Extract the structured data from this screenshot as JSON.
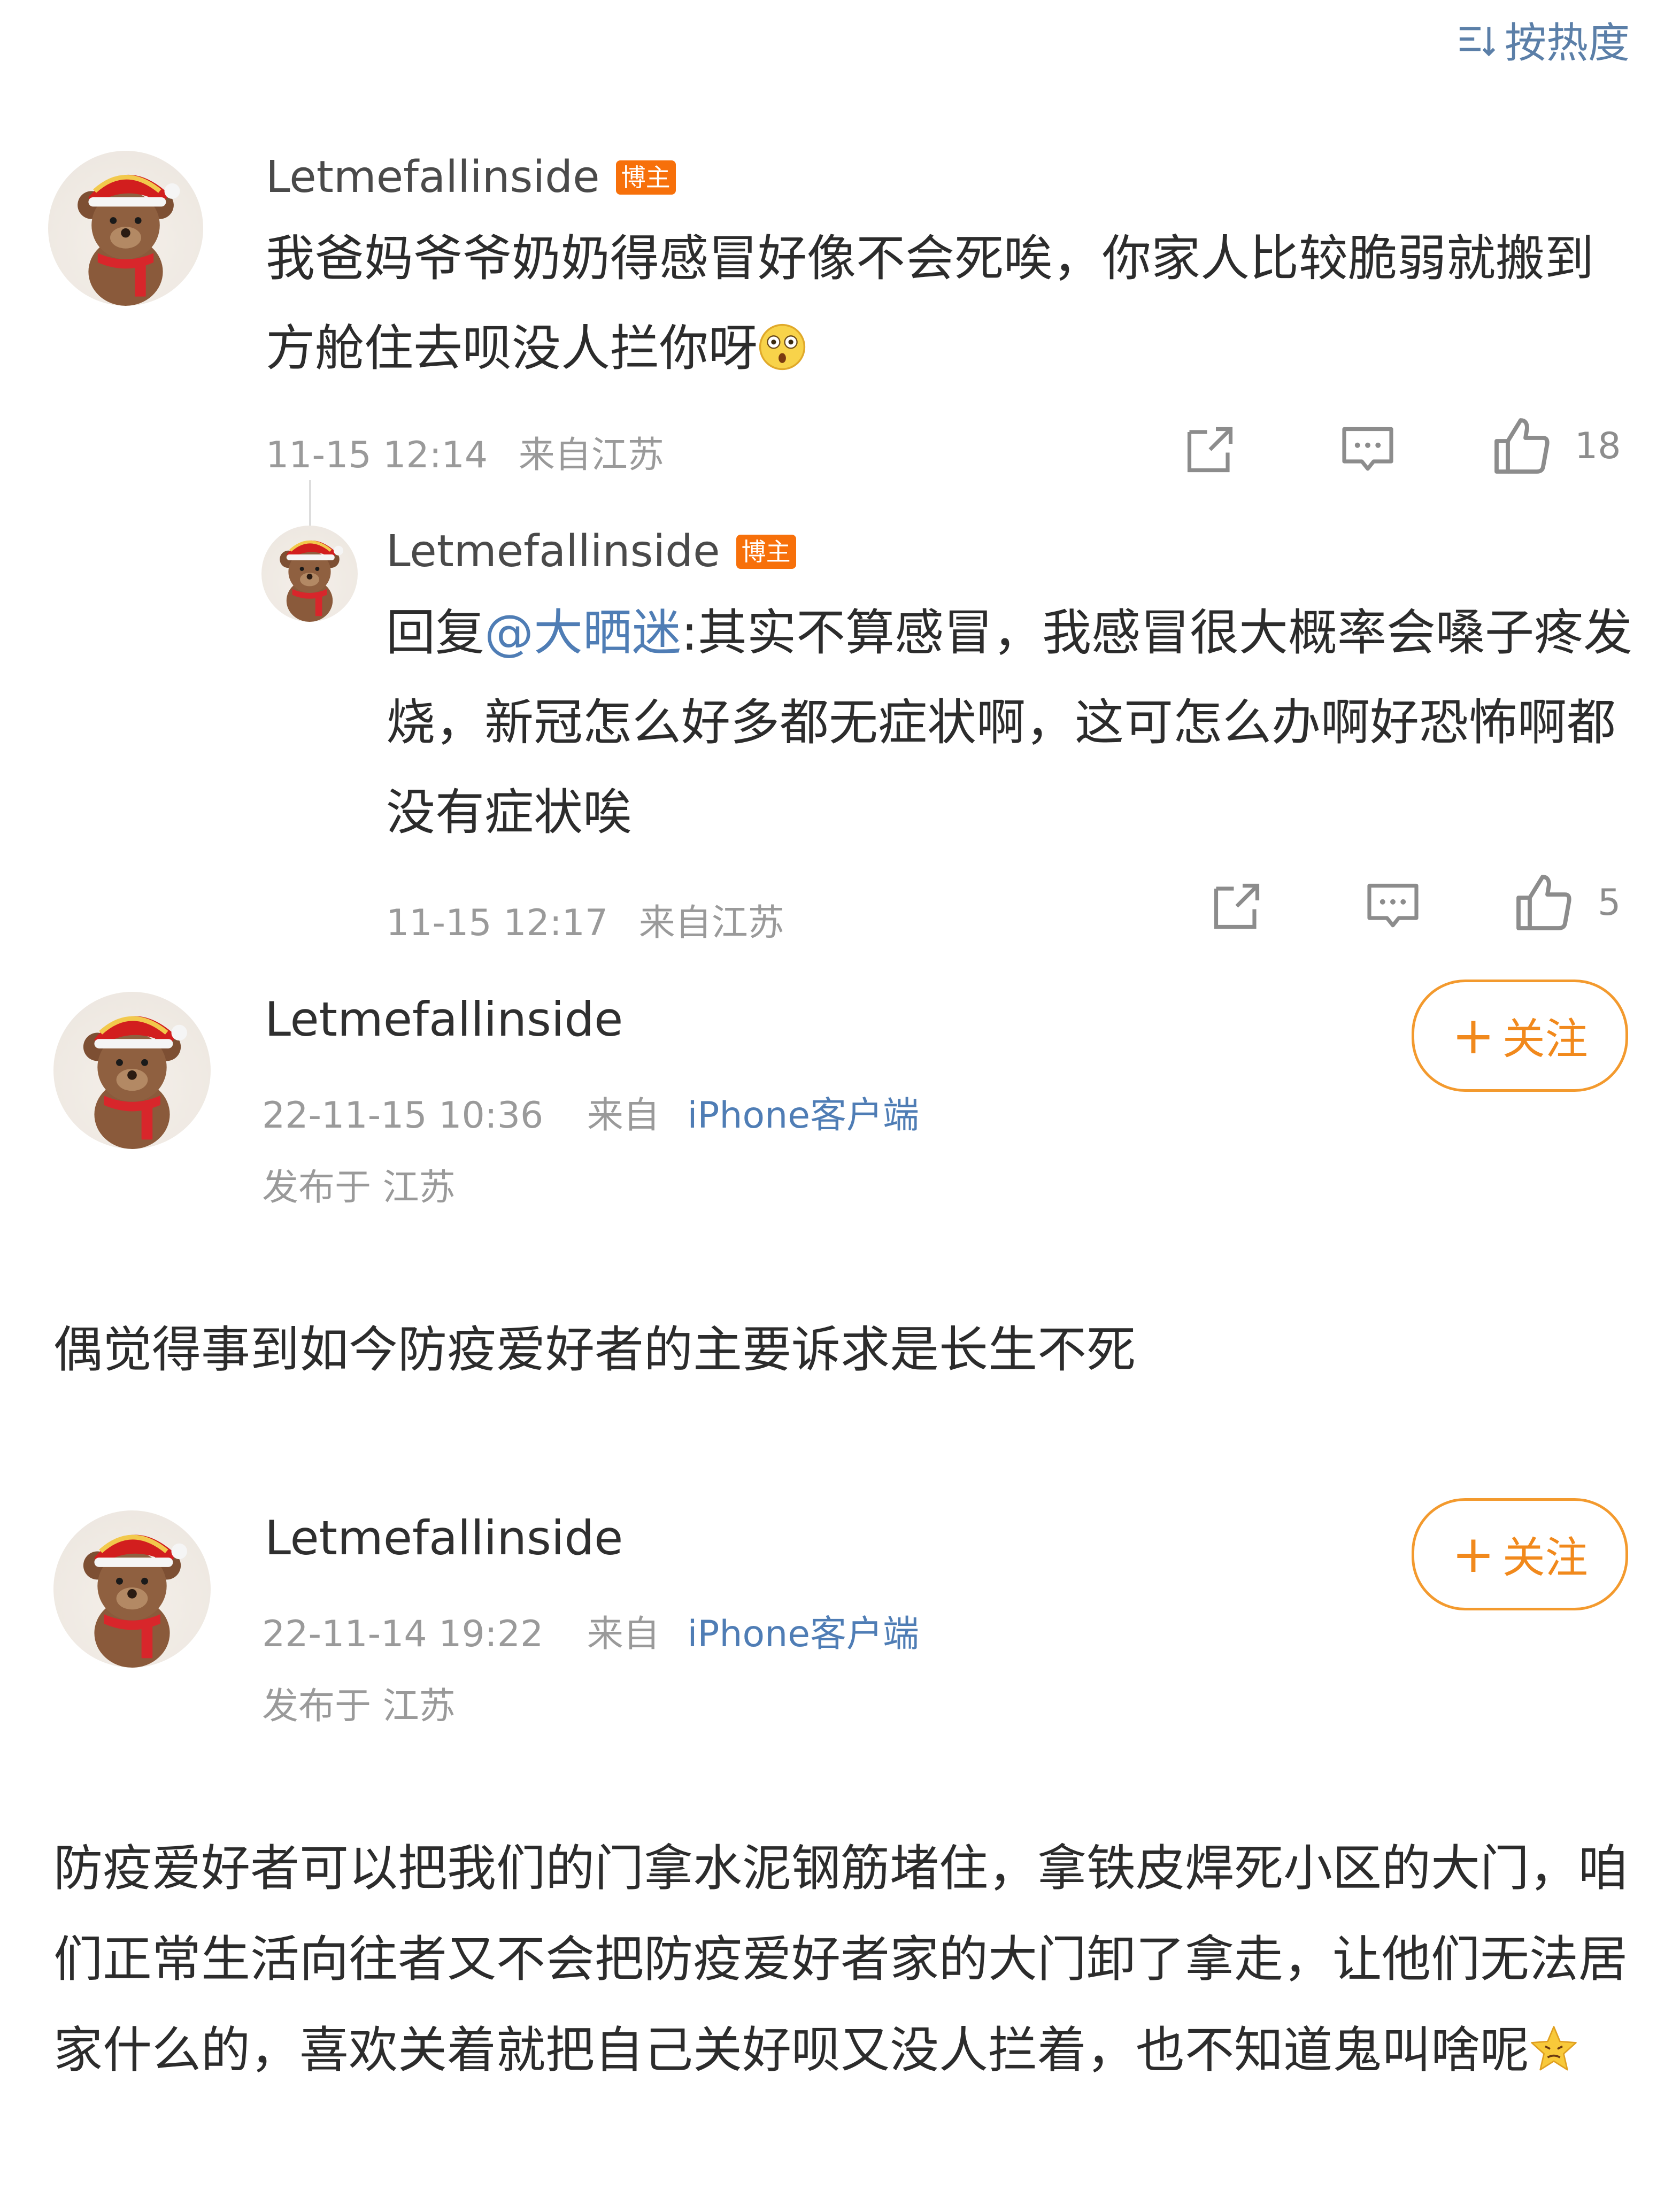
{
  "sort": {
    "label": "按热度"
  },
  "comments": [
    {
      "username": "Letmefallinside",
      "badge": "博主",
      "text": "我爸妈爷爷奶奶得感冒好像不会死唉，你家人比较脆弱就搬到方舱住去呗没人拦你呀",
      "time": "11-15 12:14",
      "location": "来自江苏",
      "likes": "18",
      "emoji": "flushed-face"
    },
    {
      "username": "Letmefallinside",
      "badge": "博主",
      "reply_prefix": "回复",
      "mention": "@大晒迷",
      "text": ":其实不算感冒，我感冒很大概率会嗓子疼发烧，新冠怎么好多都无症状啊，这可怎么办啊好恐怖啊都没有症状唉",
      "time": "11-15 12:17",
      "location": "来自江苏",
      "likes": "5"
    }
  ],
  "posts": [
    {
      "username": "Letmefallinside",
      "follow_label": "关注",
      "time": "22-11-15 10:36",
      "from": "来自",
      "client": "iPhone客户端",
      "location": "发布于 江苏",
      "text": "偶觉得事到如今防疫爱好者的主要诉求是长生不死"
    },
    {
      "username": "Letmefallinside",
      "follow_label": "关注",
      "time": "22-11-14 19:22",
      "from": "来自",
      "client": "iPhone客户端",
      "location": "发布于 江苏",
      "text": "防疫爱好者可以把我们的门拿水泥钢筋堵住，拿铁皮焊死小区的大门，咱们正常生活向往者又不会把防疫爱好者家的大门卸了拿走，让他们无法居家什么的，喜欢关着就把自己关好呗又没人拦着，也不知道鬼叫啥呢",
      "emoji": "angry-star-face"
    }
  ],
  "colors": {
    "accent_orange": "#f39a2e",
    "badge_orange": "#f7700a",
    "link_blue": "#4f7db5"
  }
}
